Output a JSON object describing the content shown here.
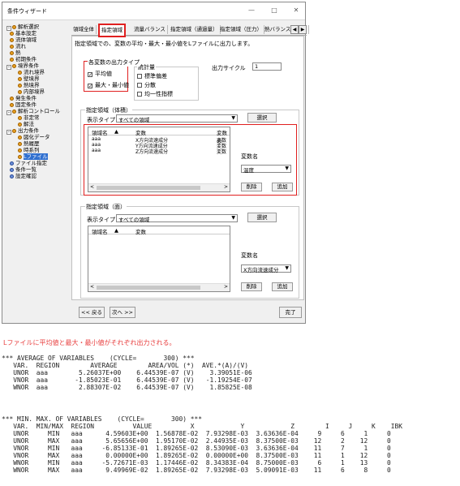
{
  "window": {
    "title": "条件ウィザード",
    "min": "—",
    "max": "□",
    "close": "✕"
  },
  "tree": {
    "items": [
      {
        "label": "解析選択",
        "expander": "-"
      },
      {
        "label": "基本設定"
      },
      {
        "label": "流体領域"
      },
      {
        "label": "流れ"
      },
      {
        "label": "熱"
      },
      {
        "label": "初期条件"
      },
      {
        "label": "境界条件",
        "expander": "-"
      },
      {
        "label": "流れ境界"
      },
      {
        "label": "壁境界"
      },
      {
        "label": "熱境界"
      },
      {
        "label": "内部境界"
      },
      {
        "label": "発生条件"
      },
      {
        "label": "固定条件"
      },
      {
        "label": "解析コントロール",
        "expander": "-"
      },
      {
        "label": "非定常"
      },
      {
        "label": "解法"
      },
      {
        "label": "出力条件",
        "expander": "-"
      },
      {
        "label": "図化データ"
      },
      {
        "label": "熱履歴"
      },
      {
        "label": "時系列"
      },
      {
        "label": "Lファイル"
      },
      {
        "label": "ファイル指定"
      },
      {
        "label": "条件一覧"
      },
      {
        "label": "設定確認"
      }
    ]
  },
  "tabs": [
    "領域全体",
    "指定領域",
    "流量バランス",
    "指定領域（通過量）",
    "指定領域（圧力）",
    "熱バランス（部品"
  ],
  "tab_scroll": {
    "left": "◀",
    "right": "▶"
  },
  "panel": {
    "description": "指定領域での、変数の平均・最大・最小値をLファイルに出力します。",
    "output_type_title": "各変数の出力タイプ",
    "avg_label": "平均値",
    "minmax_label": "最大・最小値",
    "check_mark": "✓",
    "stats_title": "統計量",
    "std_label": "標準偏差",
    "var_label": "分散",
    "unif_label": "均一性指標",
    "cycle_label": "出力サイクル",
    "cycle_value": "1",
    "spec1": {
      "title": "指定領域（体積）",
      "display_type_label": "表示タイプ",
      "display_type_value": "すべての領域",
      "select_button": "選択",
      "columns": [
        "領域名",
        "▲",
        "変数",
        "変数の"
      ],
      "rows": [
        [
          "aaa",
          "X方向流速成分",
          "変数"
        ],
        [
          "aaa",
          "Y方向流速成分",
          "変数"
        ],
        [
          "aaa",
          "Z方向流速成分",
          "変数"
        ]
      ],
      "varname_label": "変数名",
      "var_value": "温度",
      "delete_button": "削除",
      "add_button": "追加"
    },
    "spec2": {
      "title": "指定領域（面）",
      "display_type_label": "表示タイプ",
      "display_type_value": "すべての領域",
      "select_button": "選択",
      "columns": [
        "領域名",
        "▲",
        "変数"
      ],
      "varname_label": "変数名",
      "var_value": "X方向流速成分",
      "delete_button": "削除",
      "add_button": "追加"
    },
    "scroll_left": "<",
    "scroll_right": ">",
    "dropdown_arrow": "▼"
  },
  "footer": {
    "back": "<< 戻る",
    "next": "次へ >>",
    "finish": "完了"
  },
  "caption": "Lファイルに平均値と最大・最小値がそれぞれ出力される。",
  "output": {
    "avg_block": "*** AVERAGE OF VARIABLES    (CYCLE=       300) ***\n   VAR.  REGION        AVERAGE        AREA/VOL (*)  AVE.*(A)/(V)\n   UNOR  aaa        5.26037E+00    6.44539E-07 (V)    3.39051E-06\n   VNOR  aaa       -1.85023E-01    6.44539E-07 (V)   -1.19254E-07\n   WNOR  aaa        2.88307E-02    6.44539E-07 (V)    1.85825E-08",
    "minmax_block": "*** MIN. MAX. OF VARIABLES    (CYCLE=       300) ***\n   VAR.  MIN/MAX  REGION          VALUE          X            Y            Z        I     J     K    IBK\n   UNOR     MIN   aaa      4.59603E+00  1.56878E-02  7.93298E-03  3.63636E-04     9     6     1     0\n   UNOR     MAX   aaa      5.65656E+00  1.95170E-02  2.44935E-03  8.37500E-03    12     2    12     0\n   VNOR     MIN   aaa     -6.85133E-01  1.89265E-02  8.53090E-03  3.63636E-04    11     7     1     0\n   VNOR     MAX   aaa      0.00000E+00  1.89265E-02  0.00000E+00  8.37500E-03    11     1    12     0\n   WNOR     MIN   aaa     -5.72671E-03  1.17446E-02  8.34383E-04  8.75000E-03     6     1    13     0\n   WNOR     MAX   aaa      9.49969E-02  1.89265E-02  7.93298E-03  5.09091E-03    11     6     8     0"
  }
}
